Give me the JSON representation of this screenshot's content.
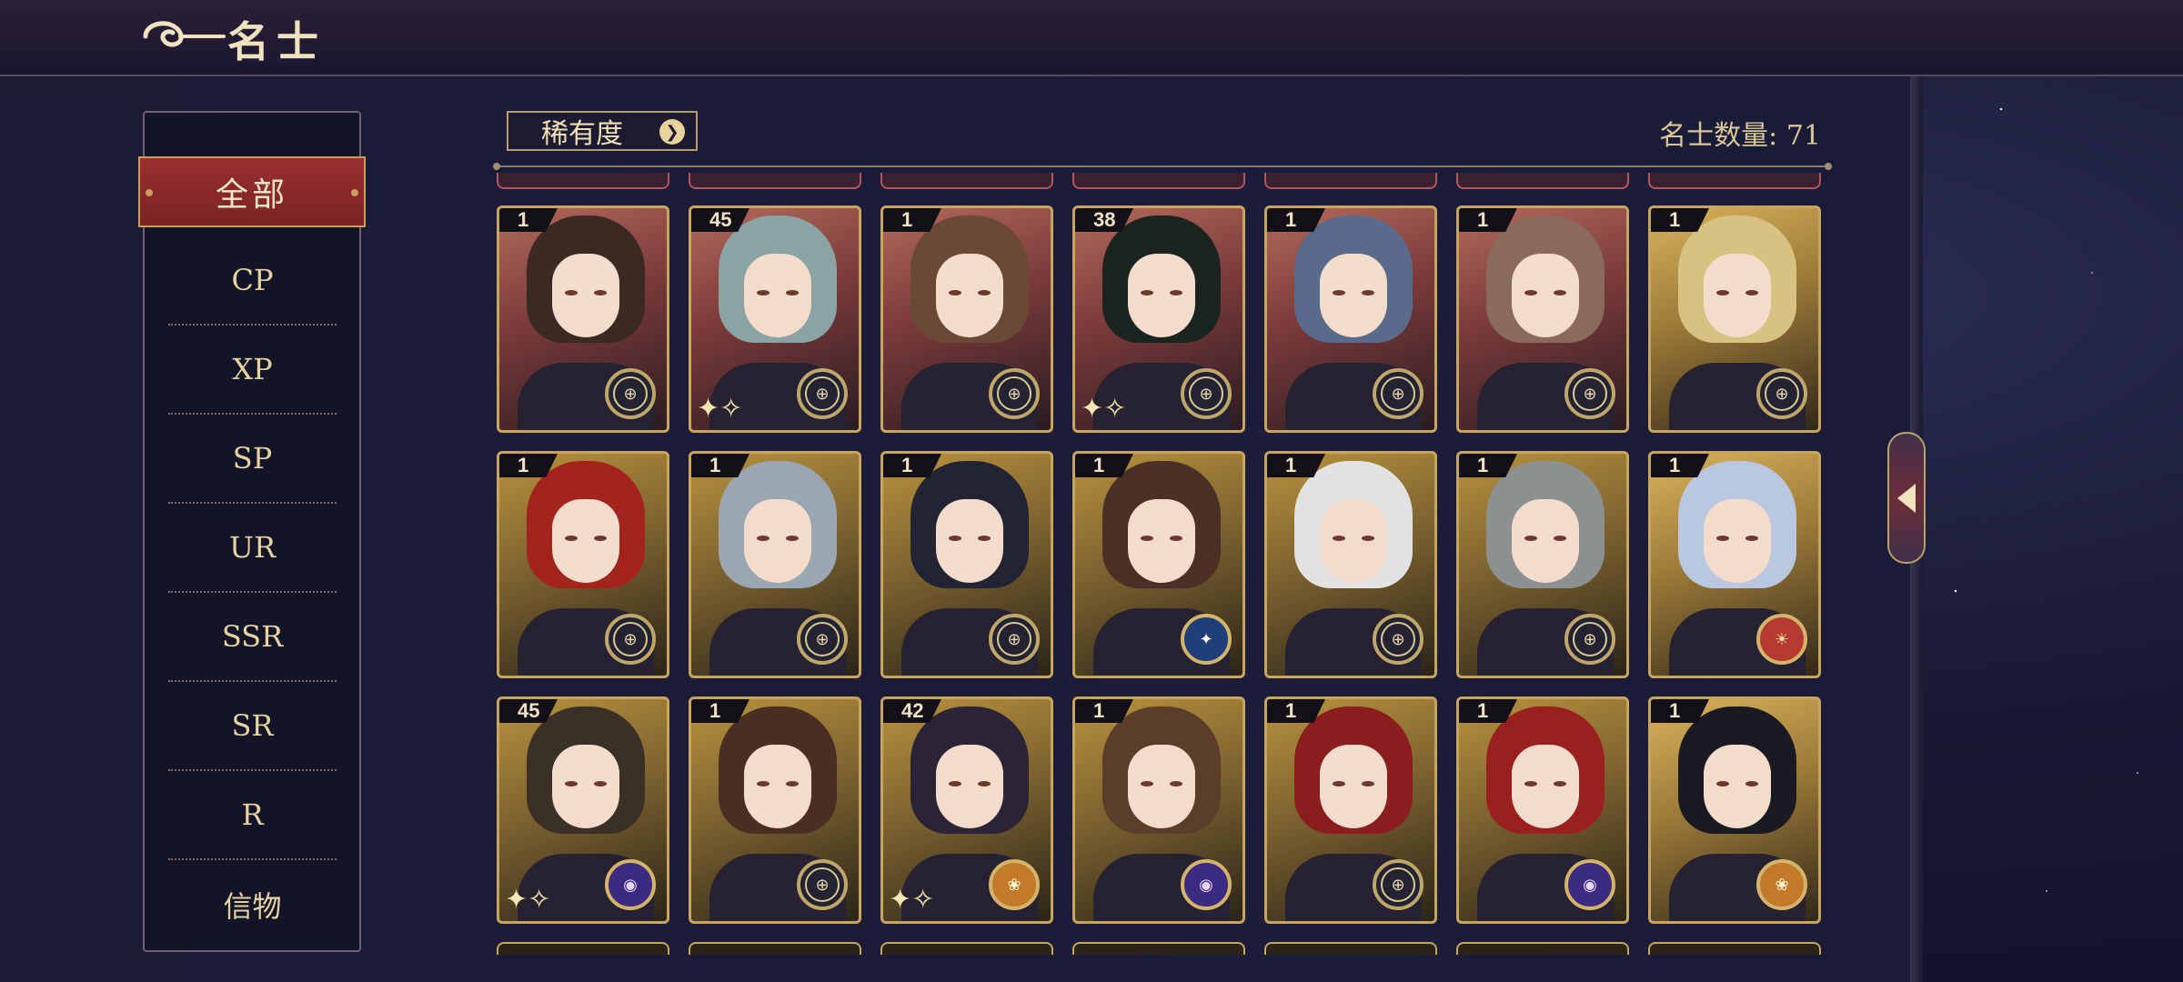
{
  "header": {
    "title": "名士"
  },
  "sidebar": {
    "active": "全部",
    "items": [
      "CP",
      "XP",
      "SP",
      "UR",
      "SSR",
      "SR",
      "R",
      "信物"
    ]
  },
  "filter": {
    "label": "稀有度",
    "chevron_icon": "chevron-down-icon"
  },
  "count_text": "名士数量: 71",
  "colors": {
    "accent_red": "#9a2f2e",
    "gold": "#c7a55e",
    "panel": "#1c1d3a"
  },
  "cards": [
    {
      "level": "1",
      "bg": "red",
      "hair": "#3a2a22",
      "emblem": "dark",
      "sparkle": false
    },
    {
      "level": "45",
      "bg": "red",
      "hair": "#8aa3a3",
      "emblem": "dark",
      "sparkle": true
    },
    {
      "level": "1",
      "bg": "red",
      "hair": "#6a4a36",
      "emblem": "dark",
      "sparkle": false
    },
    {
      "level": "38",
      "bg": "red",
      "hair": "#1c2420",
      "emblem": "dark",
      "sparkle": true
    },
    {
      "level": "1",
      "bg": "red",
      "hair": "#5a6a8a",
      "emblem": "dark",
      "sparkle": false
    },
    {
      "level": "1",
      "bg": "red",
      "hair": "#8a6a5a",
      "emblem": "dark",
      "sparkle": false
    },
    {
      "level": "1",
      "bg": "goldlight",
      "hair": "#d8c282",
      "emblem": "dark",
      "sparkle": false
    },
    {
      "level": "1",
      "bg": "gold",
      "hair": "#a3231e",
      "emblem": "dark",
      "sparkle": false
    },
    {
      "level": "1",
      "bg": "gold",
      "hair": "#9aa6b2",
      "emblem": "dark",
      "sparkle": false
    },
    {
      "level": "1",
      "bg": "gold",
      "hair": "#222433",
      "emblem": "dark",
      "sparkle": false
    },
    {
      "level": "1",
      "bg": "gold",
      "hair": "#4a3026",
      "emblem": "blue",
      "sparkle": false
    },
    {
      "level": "1",
      "bg": "gold",
      "hair": "#e2e2e2",
      "emblem": "dark",
      "sparkle": false
    },
    {
      "level": "1",
      "bg": "gold",
      "hair": "#8c9090",
      "emblem": "dark",
      "sparkle": false
    },
    {
      "level": "1",
      "bg": "goldlight",
      "hair": "#b9c8e0",
      "emblem": "red",
      "sparkle": false
    },
    {
      "level": "45",
      "bg": "gold",
      "hair": "#3a3026",
      "emblem": "purple",
      "sparkle": true
    },
    {
      "level": "1",
      "bg": "gold",
      "hair": "#4a2e22",
      "emblem": "dark",
      "sparkle": false
    },
    {
      "level": "42",
      "bg": "gold",
      "hair": "#2a2436",
      "emblem": "orange",
      "sparkle": true
    },
    {
      "level": "1",
      "bg": "gold",
      "hair": "#5a3e2a",
      "emblem": "purple",
      "sparkle": false
    },
    {
      "level": "1",
      "bg": "gold",
      "hair": "#8a1e1e",
      "emblem": "dark",
      "sparkle": false
    },
    {
      "level": "1",
      "bg": "gold",
      "hair": "#9a2020",
      "emblem": "purple",
      "sparkle": false
    },
    {
      "level": "1",
      "bg": "goldlight",
      "hair": "#1a1a22",
      "emblem": "orange",
      "sparkle": false
    }
  ]
}
